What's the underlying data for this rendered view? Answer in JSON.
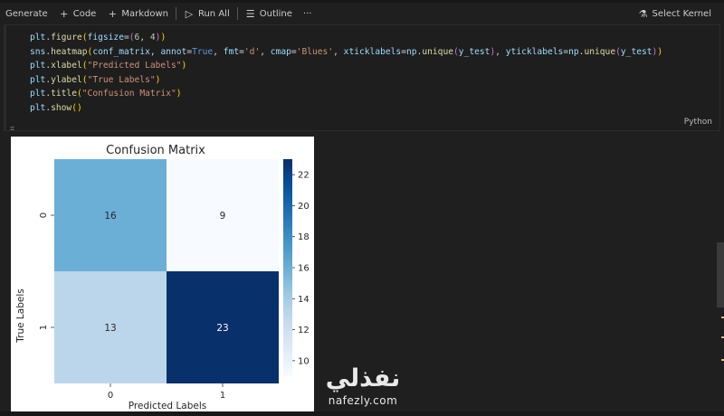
{
  "toolbar": {
    "generate": "Generate",
    "code": "Code",
    "markdown": "Markdown",
    "run_all": "Run All",
    "outline": "Outline",
    "more": "···",
    "select_kernel": "Select Kernel"
  },
  "cell": {
    "language": "Python",
    "lines": [
      "plt.figure(figsize=(6, 4))",
      "sns.heatmap(conf_matrix, annot=True, fmt='d', cmap='Blues', xticklabels=np.unique(y_test), yticklabels=np.unique(y_test))",
      "plt.xlabel(\"Predicted Labels\")",
      "plt.ylabel(\"True Labels\")",
      "plt.title(\"Confusion Matrix\")",
      "plt.show()"
    ]
  },
  "chart_data": {
    "type": "heatmap",
    "title": "Confusion Matrix",
    "xlabel": "Predicted Labels",
    "ylabel": "True Labels",
    "x_categories": [
      "0",
      "1"
    ],
    "y_categories": [
      "0",
      "1"
    ],
    "values": [
      [
        16,
        9
      ],
      [
        13,
        23
      ]
    ],
    "colormap": "Blues",
    "colorbar": {
      "range": [
        9,
        23
      ],
      "ticks": [
        10,
        12,
        14,
        16,
        18,
        20,
        22
      ]
    },
    "colors": {
      "low": "#f7fbff",
      "high": "#08306b"
    }
  },
  "watermark": {
    "arabic": "نفذلي",
    "url": "nafezly.com"
  }
}
